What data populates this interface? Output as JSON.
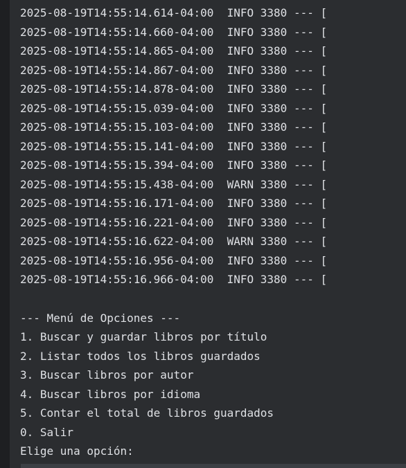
{
  "console": {
    "log_lines": [
      "2025-08-19T14:55:14.614-04:00  INFO 3380 --- [",
      "2025-08-19T14:55:14.660-04:00  INFO 3380 --- [",
      "2025-08-19T14:55:14.865-04:00  INFO 3380 --- [",
      "2025-08-19T14:55:14.867-04:00  INFO 3380 --- [",
      "2025-08-19T14:55:14.878-04:00  INFO 3380 --- [",
      "2025-08-19T14:55:15.039-04:00  INFO 3380 --- [",
      "2025-08-19T14:55:15.103-04:00  INFO 3380 --- [",
      "2025-08-19T14:55:15.141-04:00  INFO 3380 --- [",
      "2025-08-19T14:55:15.394-04:00  INFO 3380 --- [",
      "2025-08-19T14:55:15.438-04:00  WARN 3380 --- [",
      "2025-08-19T14:55:16.171-04:00  INFO 3380 --- [",
      "2025-08-19T14:55:16.221-04:00  INFO 3380 --- [",
      "2025-08-19T14:55:16.622-04:00  WARN 3380 --- [",
      "2025-08-19T14:55:16.956-04:00  INFO 3380 --- [",
      "2025-08-19T14:55:16.966-04:00  INFO 3380 --- ["
    ],
    "menu": {
      "header": "--- Menú de Opciones ---",
      "options": [
        "1. Buscar y guardar libros por título",
        "2. Listar todos los libros guardados",
        "3. Buscar libros por autor",
        "4. Buscar libros por idioma",
        "5. Contar el total de libros guardados",
        "0. Salir"
      ],
      "prompt": "Elige una opción:"
    }
  },
  "colors": {
    "background": "#2b2d30",
    "text": "#dfe1e5"
  }
}
